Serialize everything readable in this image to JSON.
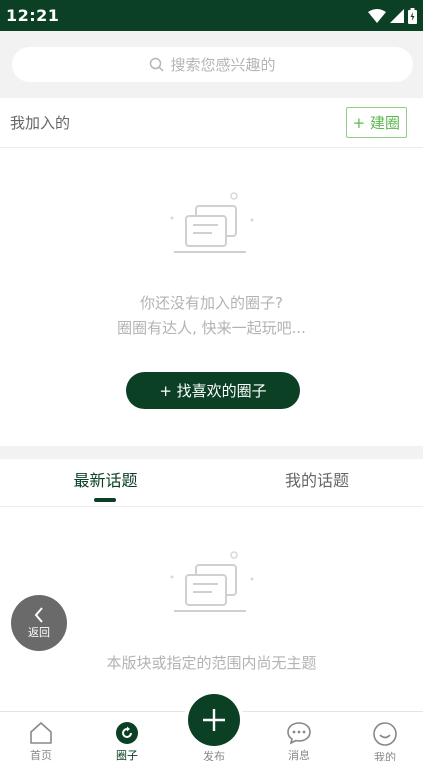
{
  "status_bar": {
    "time": "12:21"
  },
  "search": {
    "placeholder": "搜索您感兴趣的"
  },
  "my_circles": {
    "title": "我加入的",
    "create_button": "+ 建圈",
    "empty_line1": "你还没有加入的圈子?",
    "empty_line2": "圈圈有达人, 快来一起玩吧...",
    "find_button": "+ 找喜欢的圈子"
  },
  "topics": {
    "tabs": [
      {
        "label": "最新话题",
        "active": true
      },
      {
        "label": "我的话题",
        "active": false
      }
    ],
    "empty_text": "本版块或指定的范围内尚无主题"
  },
  "back_button": {
    "label": "返回"
  },
  "bottom_nav": {
    "items": [
      {
        "label": "首页",
        "icon": "home-icon"
      },
      {
        "label": "圈子",
        "icon": "circle-refresh-icon",
        "active": true
      },
      {
        "label": "发布",
        "icon": "plus-icon"
      },
      {
        "label": "消息",
        "icon": "chat-icon"
      },
      {
        "label": "我的",
        "icon": "smile-icon"
      }
    ]
  },
  "colors": {
    "brand": "#0b4025",
    "accent_green": "#5cb84f"
  }
}
